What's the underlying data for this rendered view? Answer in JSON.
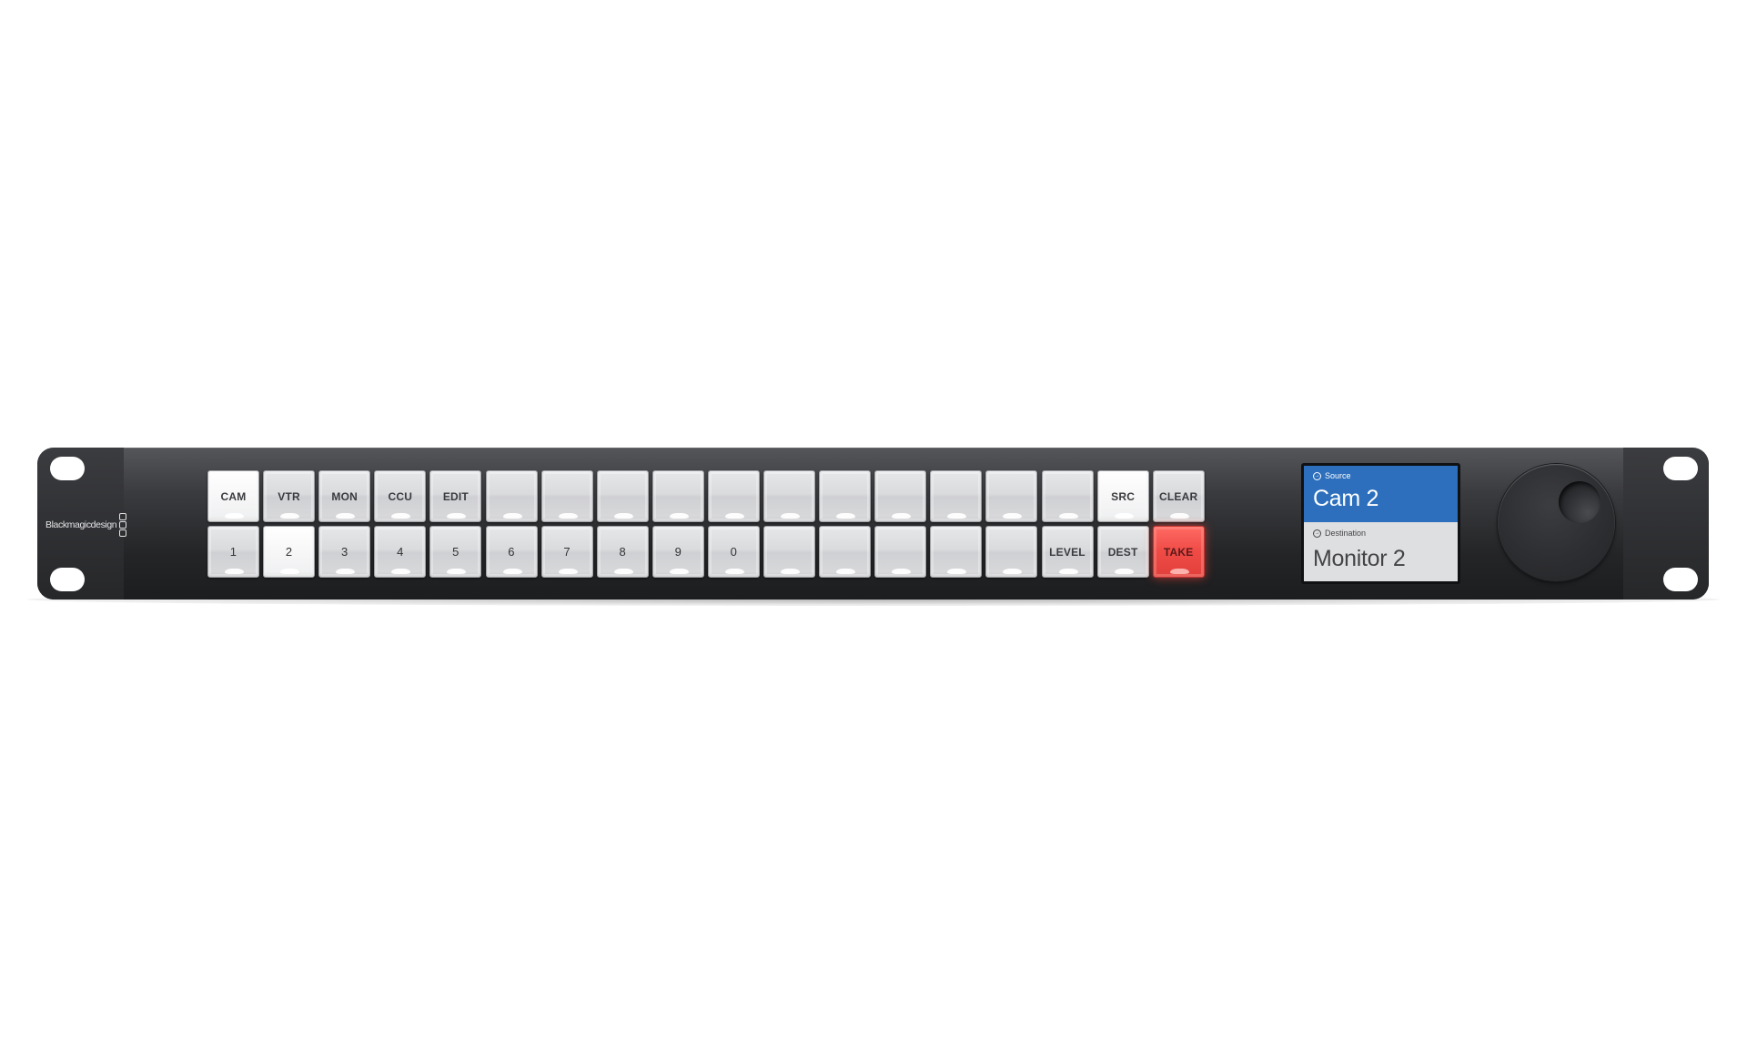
{
  "device": {
    "brand": "Blackmagicdesign",
    "type": "router control panel"
  },
  "keys": {
    "row1": [
      {
        "label": "CAM",
        "state": "lit"
      },
      {
        "label": "VTR",
        "state": "normal"
      },
      {
        "label": "MON",
        "state": "normal"
      },
      {
        "label": "CCU",
        "state": "normal"
      },
      {
        "label": "EDIT",
        "state": "normal"
      },
      {
        "label": "",
        "state": "normal"
      },
      {
        "label": "",
        "state": "normal"
      },
      {
        "label": "",
        "state": "normal"
      },
      {
        "label": "",
        "state": "normal"
      },
      {
        "label": "",
        "state": "normal"
      },
      {
        "label": "",
        "state": "normal"
      },
      {
        "label": "",
        "state": "normal"
      },
      {
        "label": "",
        "state": "normal"
      },
      {
        "label": "",
        "state": "normal"
      },
      {
        "label": "",
        "state": "normal"
      },
      {
        "label": "",
        "state": "normal"
      },
      {
        "label": "SRC",
        "state": "lit"
      },
      {
        "label": "CLEAR",
        "state": "normal"
      }
    ],
    "row2": [
      {
        "label": "1",
        "state": "normal"
      },
      {
        "label": "2",
        "state": "lit"
      },
      {
        "label": "3",
        "state": "normal"
      },
      {
        "label": "4",
        "state": "normal"
      },
      {
        "label": "5",
        "state": "normal"
      },
      {
        "label": "6",
        "state": "normal"
      },
      {
        "label": "7",
        "state": "normal"
      },
      {
        "label": "8",
        "state": "normal"
      },
      {
        "label": "9",
        "state": "normal"
      },
      {
        "label": "0",
        "state": "normal"
      },
      {
        "label": "",
        "state": "normal"
      },
      {
        "label": "",
        "state": "normal"
      },
      {
        "label": "",
        "state": "normal"
      },
      {
        "label": "",
        "state": "normal"
      },
      {
        "label": "",
        "state": "normal"
      },
      {
        "label": "LEVEL",
        "state": "normal"
      },
      {
        "label": "DEST",
        "state": "normal"
      },
      {
        "label": "TAKE",
        "state": "take"
      }
    ]
  },
  "lcd": {
    "source_label": "Source",
    "source_icon": "input-arrow-icon",
    "source_value": "Cam 2",
    "destination_label": "Destination",
    "destination_icon": "output-arrow-icon",
    "destination_value": "Monitor 2"
  },
  "colors": {
    "lcd_source_bg": "#2d6fbc",
    "lcd_dest_bg": "#dedfe1",
    "take_key": "#ef4a46",
    "panel": "#2a2b2e"
  }
}
